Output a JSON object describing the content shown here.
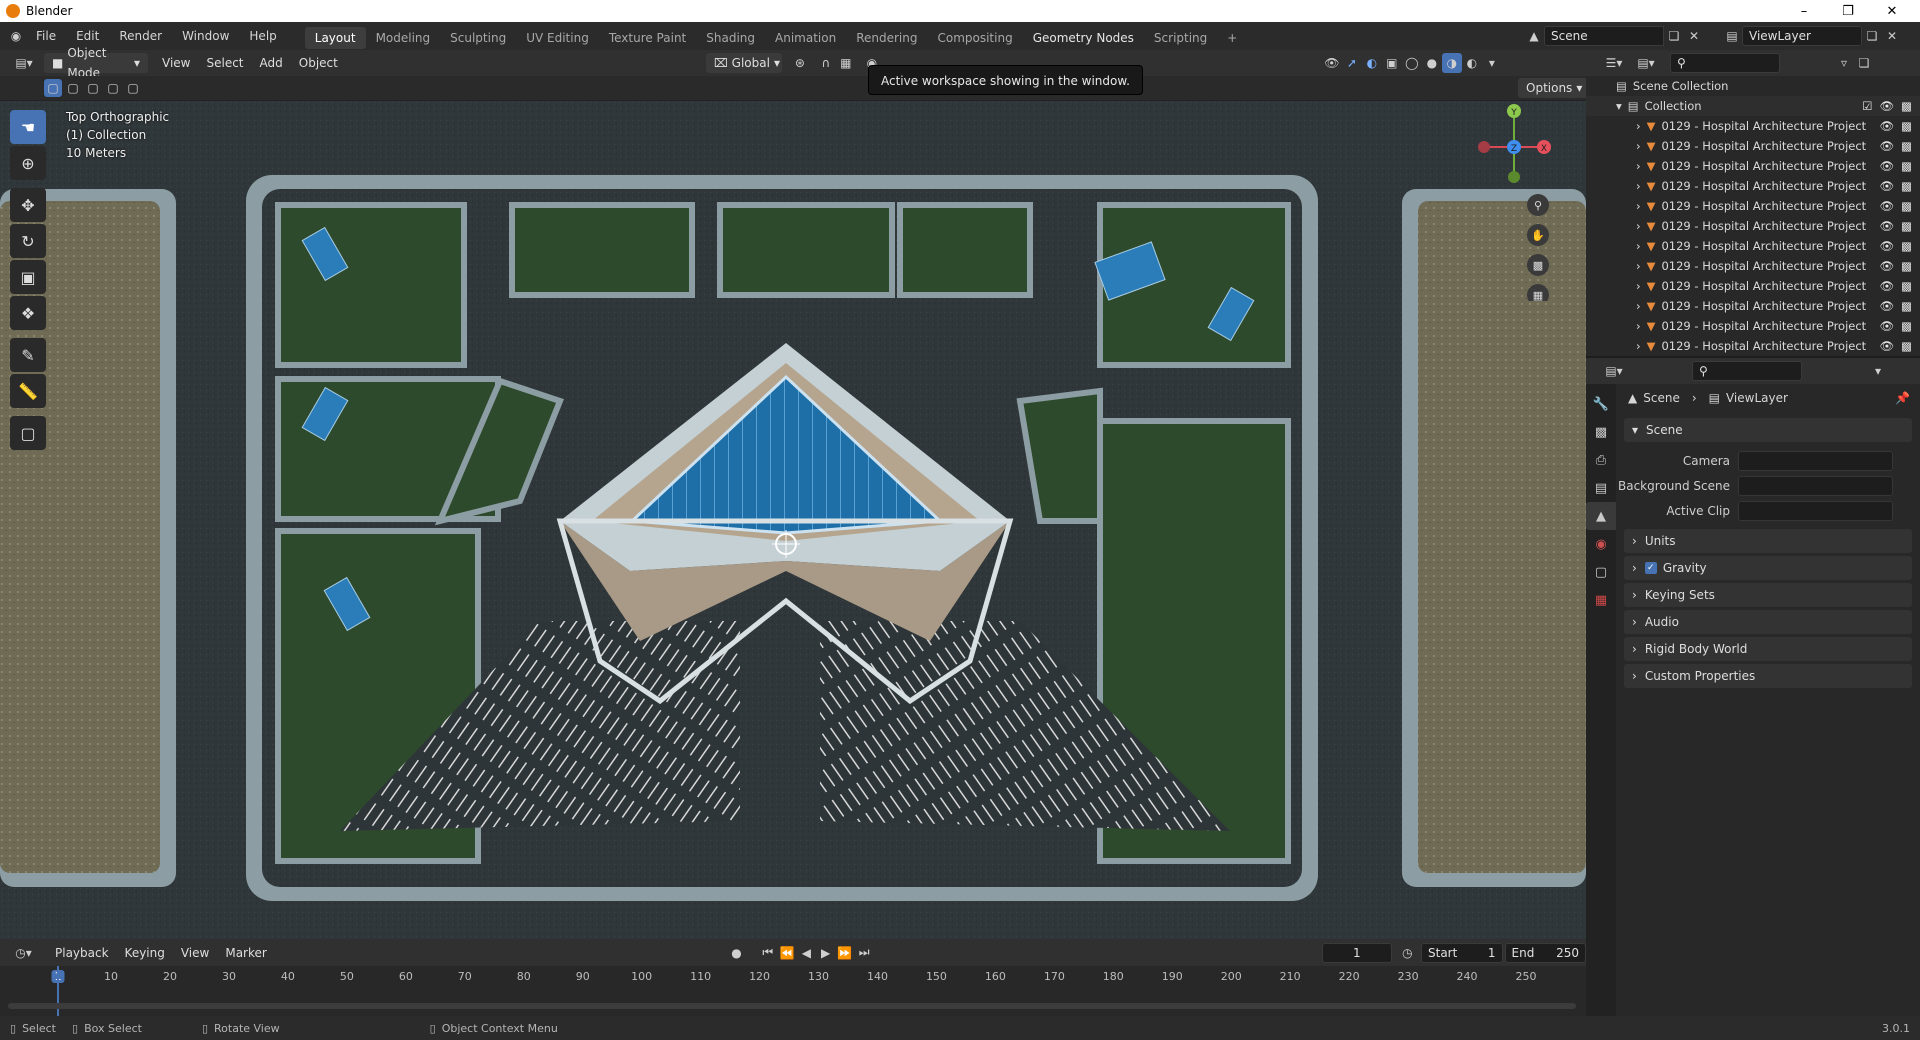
{
  "window": {
    "title": "Blender"
  },
  "menu": [
    "File",
    "Edit",
    "Render",
    "Window",
    "Help"
  ],
  "workspaces": [
    "Layout",
    "Modeling",
    "Sculpting",
    "UV Editing",
    "Texture Paint",
    "Shading",
    "Animation",
    "Rendering",
    "Compositing",
    "Geometry Nodes",
    "Scripting"
  ],
  "add_workspace": "+",
  "scene_name": "Scene",
  "view_layer_name": "ViewLayer",
  "viewport": {
    "mode": "Object Mode",
    "menus": [
      "View",
      "Select",
      "Add",
      "Object"
    ],
    "orientation": "Global",
    "options_label": "Options",
    "tooltip": "Active workspace showing in the window.",
    "info": {
      "view": "Top Orthographic",
      "collection": "(1) Collection",
      "scale": "10 Meters"
    },
    "gizmo": {
      "x": "X",
      "y": "Y",
      "z": "Z"
    }
  },
  "outliner": {
    "scene_collection": "Scene Collection",
    "collection": "Collection",
    "objects": [
      "0129 - Hospital Architecture Project",
      "0129 - Hospital Architecture Project",
      "0129 - Hospital Architecture Project",
      "0129 - Hospital Architecture Project",
      "0129 - Hospital Architecture Project",
      "0129 - Hospital Architecture Project",
      "0129 - Hospital Architecture Project",
      "0129 - Hospital Architecture Project",
      "0129 - Hospital Architecture Project",
      "0129 - Hospital Architecture Project",
      "0129 - Hospital Architecture Project",
      "0129 - Hospital Architecture Project"
    ]
  },
  "properties": {
    "breadcrumb_scene": "Scene",
    "breadcrumb_layer": "ViewLayer",
    "scene_panel": "Scene",
    "fields": [
      {
        "label": "Camera"
      },
      {
        "label": "Background Scene"
      },
      {
        "label": "Active Clip"
      }
    ],
    "panels": [
      "Units",
      "Gravity",
      "Keying Sets",
      "Audio",
      "Rigid Body World",
      "Custom Properties"
    ],
    "gravity_checked": true
  },
  "timeline": {
    "menus": [
      "Playback",
      "Keying",
      "View",
      "Marker"
    ],
    "current_frame": "1",
    "start_label": "Start",
    "start": "1",
    "end_label": "End",
    "end": "250",
    "ticks": [
      "1",
      "10",
      "20",
      "30",
      "40",
      "50",
      "60",
      "70",
      "80",
      "90",
      "100",
      "110",
      "120",
      "130",
      "140",
      "150",
      "160",
      "170",
      "180",
      "190",
      "200",
      "210",
      "220",
      "230",
      "240",
      "250"
    ]
  },
  "statusbar": {
    "select": "Select",
    "box_select": "Box Select",
    "rotate_view": "Rotate View",
    "context_menu": "Object Context Menu",
    "version": "3.0.1"
  },
  "colors": {
    "accent": "#4772b3",
    "grass": "#2e4a2c",
    "road": "#2f3538",
    "water_glass": "#1c6fa8",
    "sidewalk": "#8c9ea3"
  }
}
